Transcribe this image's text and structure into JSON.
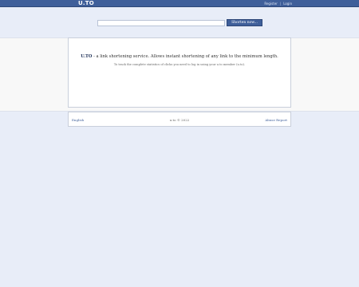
{
  "header": {
    "logo": "U.TO",
    "nav": {
      "register": "Register",
      "separator": "|",
      "login": "Login"
    }
  },
  "search": {
    "input_value": "",
    "button_label": "Shorten now..."
  },
  "main": {
    "brand": "U.TO",
    "tagline_rest": " - a link shortening service. Allows instant shortening of any link to the minimum length.",
    "hint": "To track the complete statistics of clicks you need to log in using your u.to member (u.to)."
  },
  "footer": {
    "language": "English",
    "copyright": "u.to © 2022",
    "abuse": "Abuse Report"
  },
  "colors": {
    "brand_blue": "#3f5f9a",
    "page_background": "#e8edf8",
    "panel_background": "#ffffff"
  }
}
